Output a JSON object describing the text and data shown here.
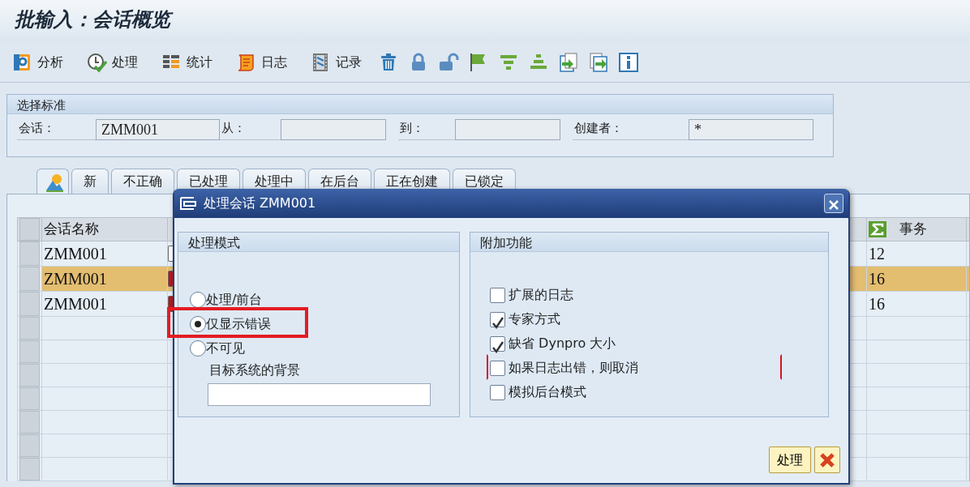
{
  "window": {
    "title": "批输入：会话概览"
  },
  "toolbar": [
    {
      "label": "分析"
    },
    {
      "label": "处理"
    },
    {
      "label": "统计"
    },
    {
      "label": "日志"
    },
    {
      "label": "记录"
    }
  ],
  "selection": {
    "title": "选择标准",
    "fields": [
      {
        "label": "会话：",
        "value": "ZMM001"
      },
      {
        "label": "从："
      },
      {
        "label": "到："
      },
      {
        "label": "创建者：",
        "value": "*"
      }
    ]
  },
  "tabs": [
    {
      "kind": "icon",
      "selected": true
    },
    {
      "label": "新",
      "selected": false
    },
    {
      "label": "不正确",
      "selected": false
    },
    {
      "label": "已处理",
      "selected": false
    },
    {
      "label": "处理中",
      "selected": false
    },
    {
      "label": "在后台",
      "selected": false
    },
    {
      "label": "正在创建",
      "selected": false
    },
    {
      "label": "已锁定",
      "selected": false
    }
  ],
  "table": {
    "columns": [
      {
        "label": "会话名称"
      },
      {
        "label": "事务",
        "kind": "sum"
      }
    ],
    "rows": [
      {
        "session": "ZMM001",
        "color": "#ffffff",
        "transactions": "12",
        "selected": false
      },
      {
        "session": "ZMM001",
        "color": "#c0141b",
        "transactions": "16",
        "selected": true
      },
      {
        "session": "ZMM001",
        "color": "#c0141b",
        "transactions": "16",
        "selected": false
      }
    ]
  },
  "dialog": {
    "title": "处理会话 ZMM001",
    "mode": {
      "title": "处理模式",
      "options": [
        {
          "label": "处理/前台",
          "selected": false,
          "highlighted": false
        },
        {
          "label": "仅显示错误",
          "selected": true,
          "highlighted": true
        },
        {
          "label": "不可见",
          "selected": false,
          "highlighted": false
        }
      ],
      "target_label": "目标系统的背景"
    },
    "extras": {
      "title": "附加功能",
      "options": [
        {
          "label": "扩展的日志",
          "checked": false,
          "focused": false
        },
        {
          "label": "专家方式",
          "checked": true,
          "focused": false
        },
        {
          "label": "缺省 Dynpro 大小",
          "checked": true,
          "focused": false
        },
        {
          "label": "如果日志出错，则取消",
          "checked": false,
          "focused": true
        },
        {
          "label": "模拟后台模式",
          "checked": false,
          "focused": false
        }
      ]
    },
    "buttons": [
      {
        "kind": "text",
        "label": "处理"
      },
      {
        "kind": "cancel"
      }
    ]
  }
}
